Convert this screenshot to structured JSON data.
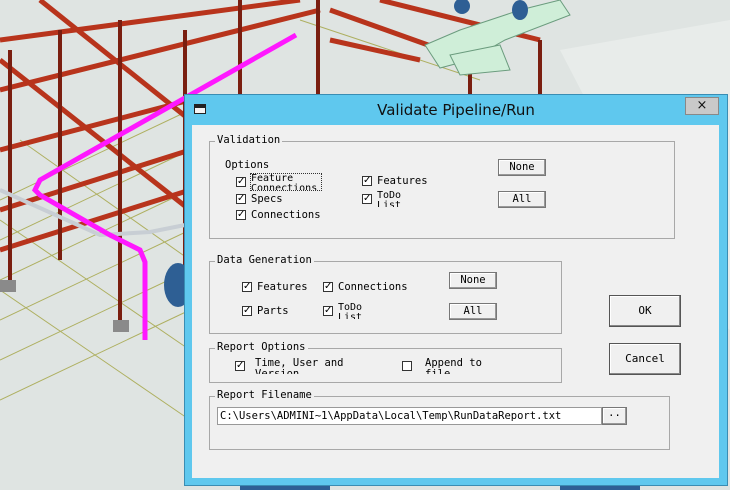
{
  "dialog": {
    "title": "Validate Pipeline/Run",
    "close_label": "×"
  },
  "validation": {
    "legend": "Validation",
    "options_label": "Options",
    "feature_connections": {
      "label": "Feature\nConnections",
      "checked": true
    },
    "specs": {
      "label": "Specs",
      "checked": true
    },
    "connections": {
      "label": "Connections",
      "checked": true
    },
    "features": {
      "label": "Features",
      "checked": true
    },
    "todo_list": {
      "label": "ToDo\nList",
      "checked": true
    },
    "none_label": "None",
    "all_label": "All"
  },
  "data_generation": {
    "legend": "Data Generation",
    "features": {
      "label": "Features",
      "checked": true
    },
    "connections": {
      "label": "Connections",
      "checked": true
    },
    "parts": {
      "label": "Parts",
      "checked": true
    },
    "todo_list": {
      "label": "ToDo\nList",
      "checked": true
    },
    "none_label": "None",
    "all_label": "All"
  },
  "report_options": {
    "legend": "Report Options",
    "time_user": {
      "label": "Time, User and\nVersion",
      "checked": true
    },
    "append": {
      "label": "Append to\nfile",
      "checked": false
    }
  },
  "report_filename": {
    "legend": "Report Filename",
    "value": "C:\\Users\\ADMINI~1\\AppData\\Local\\Temp\\RunDataReport.txt",
    "browse_label": ".."
  },
  "buttons": {
    "ok": "OK",
    "cancel": "Cancel"
  }
}
